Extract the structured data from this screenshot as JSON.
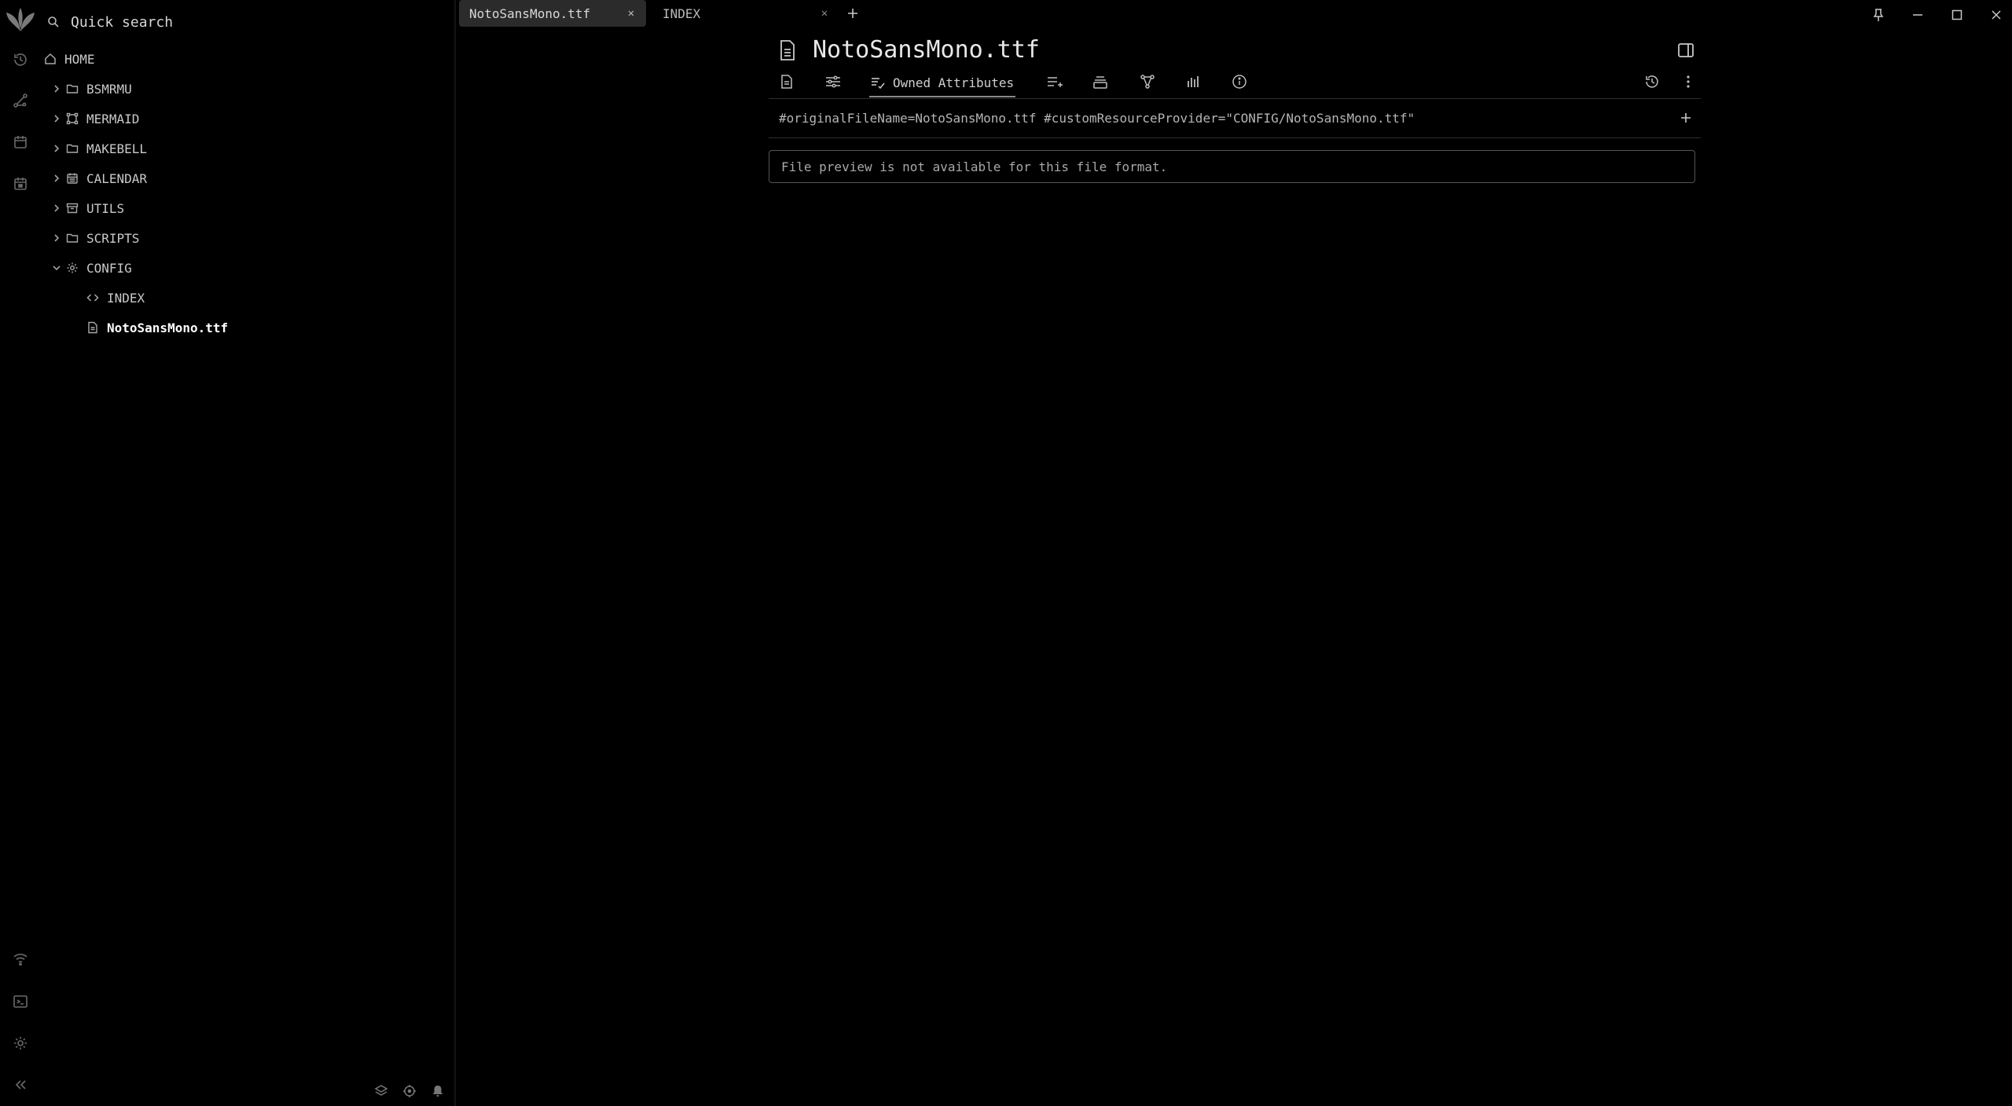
{
  "search": {
    "placeholder": "Quick search"
  },
  "tree": {
    "items": [
      {
        "label": "HOME",
        "icon": "home-icon"
      },
      {
        "label": "BSMRMU",
        "icon": "folder-icon"
      },
      {
        "label": "MERMAID",
        "icon": "diagram-icon"
      },
      {
        "label": "MAKEBELL",
        "icon": "folder-icon"
      },
      {
        "label": "CALENDAR",
        "icon": "calendar-icon"
      },
      {
        "label": "UTILS",
        "icon": "archive-icon"
      },
      {
        "label": "SCRIPTS",
        "icon": "folder-icon"
      },
      {
        "label": "CONFIG",
        "icon": "gear-icon"
      },
      {
        "label": "INDEX",
        "icon": "code-icon"
      },
      {
        "label": "NotoSansMono.ttf",
        "icon": "file-icon"
      }
    ]
  },
  "tabs": [
    {
      "label": "NotoSansMono.ttf",
      "active": true
    },
    {
      "label": "INDEX",
      "active": false
    }
  ],
  "note": {
    "title": "NotoSansMono.ttf",
    "owned_attributes_label": "Owned Attributes",
    "attributes": "#originalFileName=NotoSansMono.ttf #customResourceProvider=\"CONFIG/NotoSansMono.ttf\"",
    "preview_message": "File preview is not available for this file format."
  },
  "colors": {
    "background": "#000000",
    "active_tab": "#2b2b2b",
    "text": "#c8c8c8"
  }
}
